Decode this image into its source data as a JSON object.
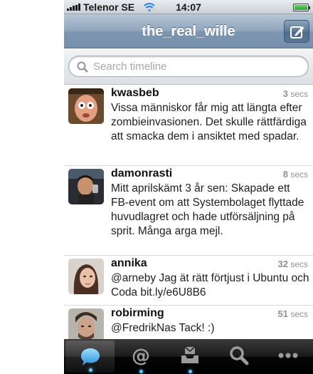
{
  "status_bar": {
    "carrier": "Telenor SE",
    "time": "14:07"
  },
  "nav": {
    "title": "the_real_wille"
  },
  "search": {
    "placeholder": "Search timeline"
  },
  "tweets": [
    {
      "user": "kwasbeb",
      "age_num": "3",
      "age_unit": "secs",
      "text": "Vissa människor får mig att längta efter zombieinvasionen. Det skulle rättfärdiga att smacka dem i ansiktet med spadar."
    },
    {
      "user": "damonrasti",
      "age_num": "8",
      "age_unit": "secs",
      "text": "Mitt aprilskämt 3 år sen: Skapade ett FB-event om att Systembolaget flyttade huvudlagret och hade utförsäljning på sprit. Många arga mejl."
    },
    {
      "user": "annika",
      "age_num": "32",
      "age_unit": "secs",
      "text": "@arneby Jag ät rätt förtjust i Ubuntu och Coda bit.ly/e6U8B6"
    },
    {
      "user": "robirming",
      "age_num": "51",
      "age_unit": "secs",
      "text": "@FredrikNas Tack! :)"
    }
  ],
  "tabs": [
    {
      "name": "timeline",
      "icon": "speech-bubble-icon"
    },
    {
      "name": "mentions",
      "icon": "at-icon"
    },
    {
      "name": "messages",
      "icon": "inbox-tray-icon"
    },
    {
      "name": "search",
      "icon": "magnifier-icon"
    },
    {
      "name": "more",
      "icon": "more-dots-icon"
    }
  ],
  "colors": {
    "accent": "#5fc6ff",
    "navbar": "#8fa5bc"
  }
}
